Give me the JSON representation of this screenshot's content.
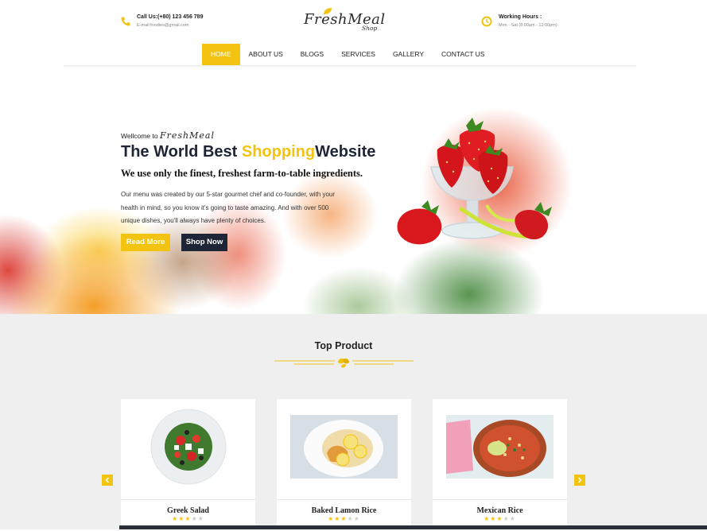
{
  "header": {
    "call_label": "Call Us:(+80) 123 456 789",
    "email": "E-mail:foodies@gmail.com",
    "logo_main": "FreshMeal",
    "logo_sub": "Shop",
    "hours_label": "Working Hours :",
    "hours_value": "Mon - Sat (8:00am - 12:00pm)"
  },
  "nav": {
    "items": [
      "HOME",
      "ABOUT US",
      "BLOGS",
      "SERVICES",
      "GALLERY",
      "CONTACT US"
    ],
    "active": "HOME"
  },
  "hero": {
    "welcome_prefix": "Wellcome to",
    "welcome_brand": "FreshMeal",
    "title_part1": "The World Best ",
    "title_highlight": "Shopping",
    "title_part2": "Website",
    "subtitle": "We use only the finest, freshest farm-to-table ingredients.",
    "paragraph": "Our menu was created by our 5-star gourmet chef and co-founder, with your health in mind, so you know it's going to taste amazing. And with over 500 unique dishes, you'll always have plenty of choices.",
    "read_more": "Read More",
    "shop_now": "Shop Now"
  },
  "products": {
    "title": "Top Product",
    "items": [
      {
        "name": "Greek Salad",
        "rating": 3
      },
      {
        "name": "Baked Lamon Rice",
        "rating": 3
      },
      {
        "name": "Mexican Rice",
        "rating": 3
      }
    ]
  },
  "colors": {
    "accent": "#f2c310",
    "dark": "#1d2536",
    "section_bg": "#efefef"
  },
  "icons": {
    "phone": "phone-icon",
    "clock": "clock-icon",
    "prev": "chevron-left-icon",
    "next": "chevron-right-icon"
  }
}
